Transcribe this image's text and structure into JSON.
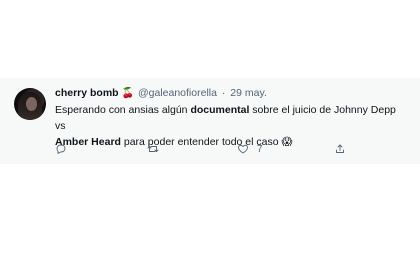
{
  "tweet": {
    "display_name": "cherry bomb",
    "name_emoji": "🍒",
    "handle": "@galeanofiorella",
    "separator": "·",
    "date": "29 may.",
    "text_part1": "Esperando con ansias algún ",
    "text_bold1": "documental",
    "text_part2": " sobre el juicio de Johnny Depp vs ",
    "text_bold2": "Amber Heard",
    "text_part3": " para poder entender todo el caso ",
    "text_emoji": "😱"
  },
  "actions": {
    "reply_icon": "reply-icon",
    "retweet_icon": "retweet-icon",
    "like_icon": "heart-icon",
    "like_count": "7",
    "share_icon": "share-icon"
  },
  "colors": {
    "background": "#f7f9f9",
    "text": "#0f1419",
    "secondary": "#536471"
  }
}
